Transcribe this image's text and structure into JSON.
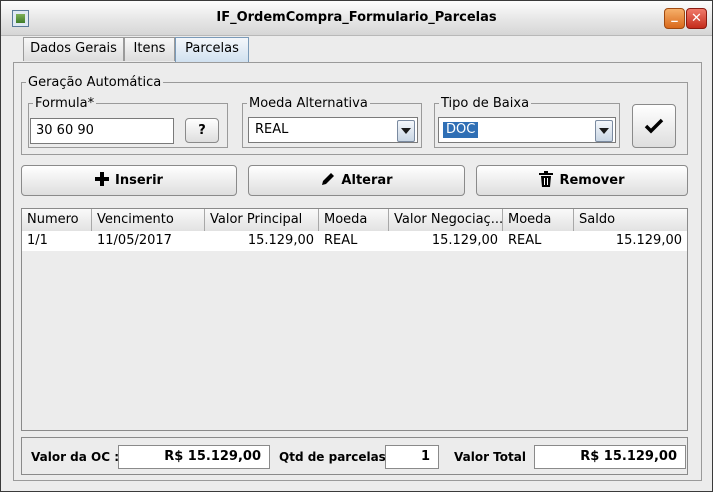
{
  "window": {
    "title": "IF_OrdemCompra_Formulario_Parcelas"
  },
  "tabs": [
    {
      "label": "Dados Gerais"
    },
    {
      "label": "Itens"
    },
    {
      "label": "Parcelas"
    }
  ],
  "geracao": {
    "legend": "Geração Automática",
    "formula": {
      "label": "Formula*",
      "value": "30 60 90",
      "help_label": "?"
    },
    "moeda": {
      "label": "Moeda Alternativa",
      "value": "REAL"
    },
    "tipo_baixa": {
      "label": "Tipo de Baixa",
      "value": "DOC"
    }
  },
  "actions": {
    "inserir": "Inserir",
    "alterar": "Alterar",
    "remover": "Remover"
  },
  "table": {
    "columns": [
      "Numero",
      "Vencimento",
      "Valor Principal",
      "Moeda",
      "Valor Negociaç...",
      "Moeda",
      "Saldo"
    ],
    "rows": [
      [
        "1/1",
        "11/05/2017",
        "15.129,00",
        "REAL",
        "15.129,00",
        "REAL",
        "15.129,00"
      ]
    ]
  },
  "footer": {
    "valor_oc_label": "Valor da OC :",
    "valor_oc": "R$ 15.129,00",
    "qtd_label": "Qtd de parcelas",
    "qtd": "1",
    "total_label": "Valor Total",
    "total": "R$ 15.129,00"
  },
  "colors": {
    "selection": "#2f6fb5",
    "title_text": "#000000"
  }
}
